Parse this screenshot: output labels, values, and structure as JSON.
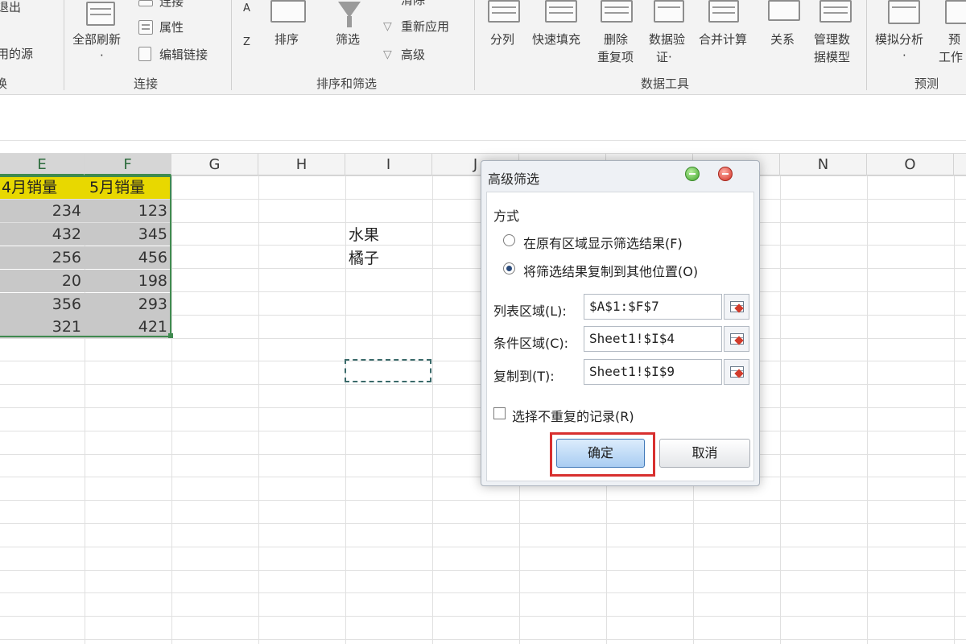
{
  "ribbon": {
    "left_group_partial": [
      "退出",
      "用的源",
      "换"
    ],
    "connections": {
      "refresh_all": "全部刷新",
      "refresh_arrow": "·",
      "connections": "连接",
      "properties": "属性",
      "edit_links": "编辑链接",
      "group_label": "连接"
    },
    "sort_filter": {
      "sort_az": "A",
      "sort_za": "Z",
      "sort": "排序",
      "filter": "筛选",
      "clear": "清除",
      "reapply": "重新应用",
      "advanced": "高级",
      "group_label": "排序和筛选"
    },
    "data_tools": {
      "text_to_columns": "分列",
      "flash_fill": "快速填充",
      "remove_duplicates_1": "删除",
      "remove_duplicates_2": "重复项",
      "data_validation_1": "数据验",
      "data_validation_2": "证·",
      "consolidate": "合并计算",
      "relationships": "关系",
      "manage_model_1": "管理数",
      "manage_model_2": "据模型",
      "group_label": "数据工具"
    },
    "forecast": {
      "what_if": "模拟分析",
      "what_if_arrow": "·",
      "forecast_sheet_1": "预",
      "forecast_sheet_2": "工作",
      "group_label": "预测"
    }
  },
  "grid": {
    "columns": [
      "E",
      "F",
      "G",
      "H",
      "I",
      "J",
      "N",
      "O"
    ],
    "selected_columns": [
      "E",
      "F"
    ],
    "header_row": [
      "4月销量",
      "5月销量"
    ],
    "rows": [
      [
        "234",
        "123"
      ],
      [
        "432",
        "345"
      ],
      [
        "256",
        "456"
      ],
      [
        "20",
        "198"
      ],
      [
        "356",
        "293"
      ],
      [
        "321",
        "421"
      ]
    ],
    "criteria_cells": [
      "水果",
      "橘子"
    ]
  },
  "dialog": {
    "title": "高级筛选",
    "method_label": "方式",
    "option_in_place": "在原有区域显示筛选结果(F)",
    "option_copy": "将筛选结果复制到其他位置(O)",
    "selected_option": "option_copy",
    "list_range_label": "列表区域(L):",
    "list_range_value": "$A$1:$F$7",
    "criteria_range_label": "条件区域(C):",
    "criteria_range_value": "Sheet1!$I$4",
    "copy_to_label": "复制到(T):",
    "copy_to_value": "Sheet1!$I$9",
    "unique_records_label": "选择不重复的记录(R)",
    "unique_records_checked": false,
    "ok_label": "确定",
    "cancel_label": "取消",
    "highlight_color": "#d8302f"
  }
}
